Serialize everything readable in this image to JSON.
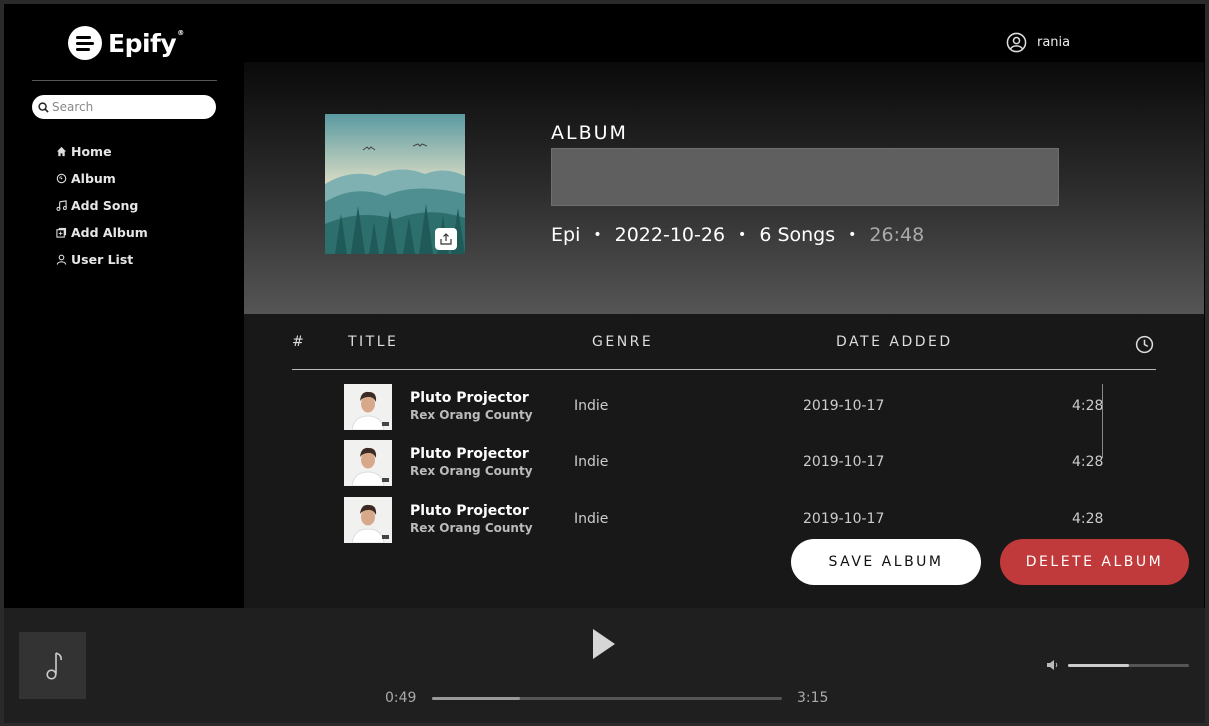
{
  "brand": {
    "name": "Epify",
    "reg": "®"
  },
  "search": {
    "placeholder": "Search"
  },
  "nav": [
    {
      "label": "Home",
      "icon": "home-icon"
    },
    {
      "label": "Album",
      "icon": "album-icon"
    },
    {
      "label": "Add Song",
      "icon": "music-note-icon"
    },
    {
      "label": "Add Album",
      "icon": "add-album-icon"
    },
    {
      "label": "User List",
      "icon": "user-icon"
    }
  ],
  "user": {
    "name": "rania"
  },
  "album": {
    "label": "ALBUM",
    "name_value": "",
    "artist": "Epi",
    "date": "2022-10-26",
    "songs": "6 Songs",
    "duration": "26:48",
    "separator": "•"
  },
  "table": {
    "headers": {
      "num": "#",
      "title": "TITLE",
      "genre": "GENRE",
      "date": "DATE ADDED"
    },
    "rows": [
      {
        "title": "Pluto Projector",
        "artist": "Rex Orang County",
        "genre": "Indie",
        "date": "2019-10-17",
        "duration": "4:28"
      },
      {
        "title": "Pluto Projector",
        "artist": "Rex Orang County",
        "genre": "Indie",
        "date": "2019-10-17",
        "duration": "4:28"
      },
      {
        "title": "Pluto Projector",
        "artist": "Rex Orang County",
        "genre": "Indie",
        "date": "2019-10-17",
        "duration": "4:28"
      }
    ]
  },
  "actions": {
    "save": "SAVE ALBUM",
    "delete": "DELETE ALBUM"
  },
  "player": {
    "elapsed": "0:49",
    "total": "3:15",
    "progress": 0.25,
    "volume": 0.5
  },
  "colors": {
    "accent": "#c0393b",
    "background": "#000000"
  }
}
